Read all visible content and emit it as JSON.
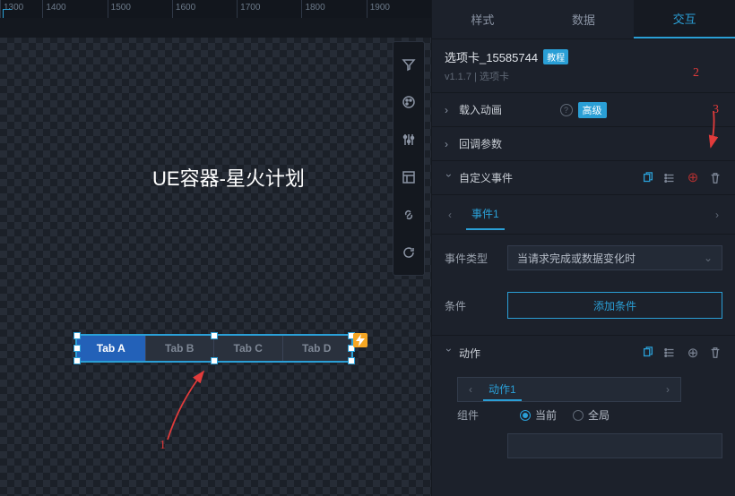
{
  "ruler": [
    "1300",
    "1400",
    "1500",
    "1600",
    "1700",
    "1800",
    "1900"
  ],
  "canvas": {
    "title": "UE容器-星火计划",
    "tabs": [
      "Tab A",
      "Tab B",
      "Tab C",
      "Tab D"
    ],
    "active_tab": 0
  },
  "annotations": {
    "1": "1",
    "2": "2",
    "3": "3"
  },
  "panel": {
    "tabs": {
      "style": "样式",
      "data": "数据",
      "interact": "交互"
    },
    "active": "interact",
    "component": {
      "name": "选项卡_15585744",
      "badge": "教程",
      "version": "v1.1.7",
      "type": "选项卡"
    },
    "sections": {
      "load_anim": "载入动画",
      "load_anim_tag": "高级",
      "callback": "回调参数",
      "custom_event": "自定义事件"
    },
    "event": {
      "tab_label": "事件1",
      "type_label": "事件类型",
      "type_value": "当请求完成或数据变化时",
      "cond_label": "条件",
      "add_cond": "添加条件"
    },
    "action": {
      "label": "动作",
      "tab": "动作1",
      "component_label": "组件",
      "radio_current": "当前",
      "radio_global": "全局"
    }
  }
}
